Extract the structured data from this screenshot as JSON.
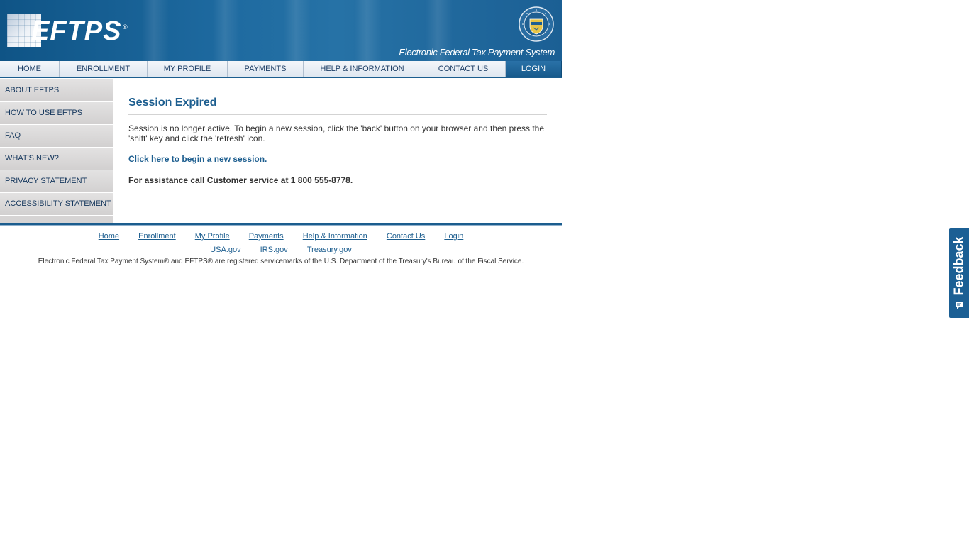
{
  "banner": {
    "logo_text": "EFTPS",
    "logo_reg": "®",
    "tagline": "Electronic Federal Tax Payment System",
    "seal_icon": "treasury-seal-icon"
  },
  "topnav": {
    "items": [
      {
        "label": "HOME"
      },
      {
        "label": "ENROLLMENT"
      },
      {
        "label": "MY PROFILE"
      },
      {
        "label": "PAYMENTS"
      },
      {
        "label": "HELP & INFORMATION"
      },
      {
        "label": "CONTACT US"
      },
      {
        "label": "LOGIN",
        "active": true
      }
    ]
  },
  "sidebar": {
    "items": [
      {
        "label": "ABOUT EFTPS"
      },
      {
        "label": "HOW TO USE EFTPS"
      },
      {
        "label": "FAQ"
      },
      {
        "label": "WHAT'S NEW?"
      },
      {
        "label": "PRIVACY STATEMENT"
      },
      {
        "label": "ACCESSIBILITY STATEMENT"
      }
    ]
  },
  "main": {
    "title": "Session Expired",
    "message": "Session is no longer active. To begin a new session, click the 'back' button on your browser and then press the 'shift' key and click the 'refresh' icon.",
    "new_session_link": "Click here to begin a new session.",
    "assistance": "For assistance call Customer service at 1 800 555-8778."
  },
  "footer": {
    "links": [
      "Home",
      "Enrollment",
      "My Profile",
      "Payments",
      "Help & Information",
      "Contact Us",
      "Login"
    ],
    "external_links": [
      "USA.gov",
      "IRS.gov",
      "Treasury.gov"
    ],
    "note": "Electronic Federal Tax Payment System® and EFTPS® are registered servicemarks of the U.S. Department of the Treasury's Bureau of the Fiscal Service."
  },
  "feedback": {
    "label": "Feedback",
    "icon": "feedback-chat-icon"
  },
  "colors": {
    "brand_blue": "#1b5d8e",
    "link_blue": "#1d5e8f",
    "sidebar_gray": "#d6d4d4"
  }
}
